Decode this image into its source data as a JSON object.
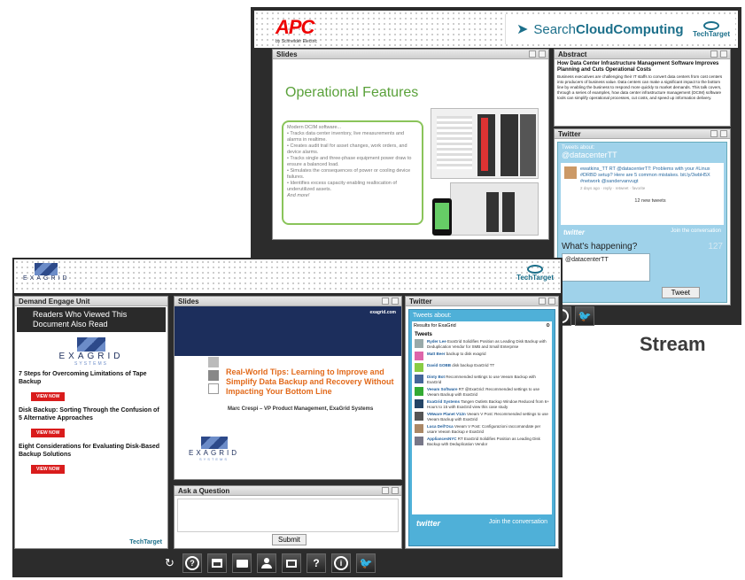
{
  "back_window": {
    "sponsor_logo": "APC",
    "sponsor_sub": "by Schneider Electric",
    "site_banner_plain": "Search",
    "site_banner_bold": "CloudComputing",
    "techtarget_logo": "TechTarget",
    "slides_label": "Slides",
    "slide_title": "Operational Features",
    "slide_intro": "Modern DCIM software...",
    "slide_bullets": [
      "Tracks data center inventory, live measurements and alarms in realtime.",
      "Creates audit trail for asset changes, work orders, and device alarms.",
      "Tracks single and three-phase equipment power draw to ensure a balanced load.",
      "Simulates the consequences of power or cooling device failures.",
      "Identifies excess capacity enabling reallocation of underutilized assets."
    ],
    "slide_more": "And more!",
    "abstract_label": "Abstract",
    "abstract_title": "How Data Center Infrastructure Management Software Improves Planning and Cuts Operational Costs",
    "abstract_body": "Business executives are challenging their IT staffs to convert data centers from cost centers into producers of business value. Data centers can make a significant impact to the bottom line by enabling the business to respond more quickly to market demands. This talk covers, through a series of examples, how data center infrastructure management (DCIM) software tools can simplify operational processes, cut costs, and speed up information delivery.",
    "twitter_label": "Twitter",
    "tweets_about": "Tweets about:",
    "tweets_handle": "@datacenterTT",
    "tweet_text": "ewatkins_TT RT @datacenterTT: Problems with your #Linux #DRBD setup? Here are 5 common mistakes. bit.ly/3wbH5X #network @sandervanvugt",
    "tweet_meta": "2 days ago · reply · retweet · favorite",
    "new_tweets": "12 new tweets",
    "twitter_brand": "twitter",
    "join": "Join the conversation",
    "whats_happening": "What's happening?",
    "char_count": "127",
    "compose_value": "@datacenterTT",
    "tweet_button": "Tweet"
  },
  "stream_label": "Stream",
  "front_window": {
    "sponsor_logo": "EXAGRID",
    "techtarget_logo": "TechTarget",
    "demand_label": "Demand Engage Unit",
    "readers_header": "Readers Who Viewed This Document Also Read",
    "doc_logo": "EXAGRID",
    "doc_logo_sub": "SYSTEMS",
    "docs": [
      {
        "title": "7 Steps for Overcoming Limitations of Tape Backup",
        "button": "VIEW NOW"
      },
      {
        "title": "Disk Backup: Sorting Through the Confusion of 5 Alternative Approaches",
        "button": "VIEW NOW"
      },
      {
        "title": "Eight Considerations for Evaluating Disk-Based Backup Solutions",
        "button": "VIEW NOW"
      }
    ],
    "footer_logo": "TechTarget",
    "slides_label": "Slides",
    "slide_url": "exagrid.com",
    "slide_title": "Real-World Tips: Learning to Improve and Simplify Data Backup and Recovery Without Impacting Your Bottom Line",
    "slide_author": "Marc Crespi – VP Product Management, ExaGrid Systems",
    "slide_logo": "EXAGRID",
    "slide_logo_sub": "SYSTEMS",
    "ask_label": "Ask a Question",
    "submit": "Submit",
    "twitter_label": "Twitter",
    "tweets_about": "Tweets about:",
    "results_for": "Results for ExaGrid",
    "tweets_header": "Tweets",
    "tweets": [
      {
        "user": "Ryder Lee",
        "text": "ExaGrid Solidifies Position as Leading Disk Backup with Deduplication Vendor for SMB and Small Enterprise"
      },
      {
        "user": "Matt Beer",
        "text": "backup to disk exagrid"
      },
      {
        "user": "David GOBB",
        "text": "disk backup ExaGrid TT"
      },
      {
        "user": "Dinty Bot",
        "text": "Recommended settings to use Veeam Backup with ExaGrid"
      },
      {
        "user": "Veeam Software",
        "text": "RT @ExaGrid: Recommended settings to use Veeam Backup with ExaGrid"
      },
      {
        "user": "ExaGrid Systems",
        "text": "Tangen Outlets Backup Window Reduced from 6+ Hours to 15 with ExaGrid view this case study"
      },
      {
        "user": "VMware Planet V12n",
        "text": "Veeam V Post: Recommended settings to use Veeam Backup with ExaGrid"
      },
      {
        "user": "Luca Dell'Oca",
        "text": "Veeam V Post: Configurazioni raccomandate per usare Veeam Backup e ExaGrid"
      },
      {
        "user": "AppliancesNYC",
        "text": "RT ExaGrid Solidifies Position as Leading Disk Backup with Deduplication Vendor"
      }
    ],
    "twitter_brand": "twitter",
    "join": "Join the conversation"
  },
  "toolbar": {
    "icons": [
      "refresh-icon",
      "help-icon",
      "window-icon",
      "folder-icon",
      "user-icon",
      "slides-icon",
      "question-icon",
      "info-icon",
      "twitter-icon"
    ]
  },
  "colors": {
    "twitter_blue": "#4fb0d8",
    "red": "#d91c1c",
    "dark": "#2a2a2a",
    "navy": "#1c2e5c",
    "green": "#5a9e2a"
  }
}
